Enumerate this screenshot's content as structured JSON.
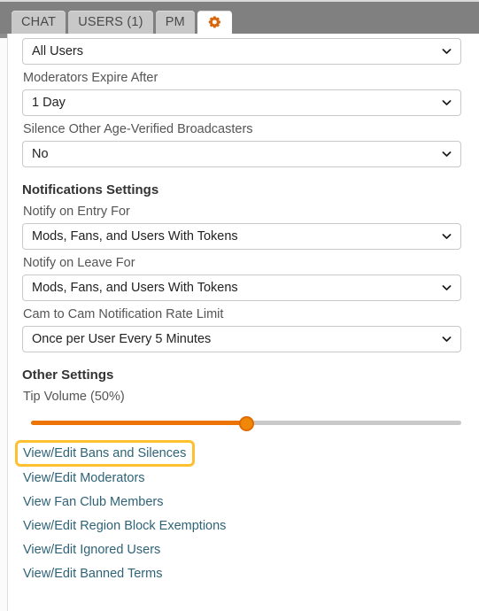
{
  "tabs": [
    {
      "label": "CHAT",
      "name": "tab-chat",
      "active": false,
      "icon": null
    },
    {
      "label": "USERS (1)",
      "name": "tab-users",
      "active": false,
      "icon": null
    },
    {
      "label": "PM",
      "name": "tab-pm",
      "active": false,
      "icon": null
    },
    {
      "label": "",
      "name": "tab-settings",
      "active": true,
      "icon": "gear-icon"
    }
  ],
  "settings": {
    "user_scope": {
      "label": "",
      "value": "All Users",
      "icon": "chevron-down-icon"
    },
    "moderators_expire": {
      "label": "Moderators Expire After",
      "value": "1 Day",
      "icon": "chevron-down-icon"
    },
    "silence_broadcasters": {
      "label": "Silence Other Age-Verified Broadcasters",
      "value": "No",
      "icon": "chevron-down-icon"
    }
  },
  "notifications": {
    "heading": "Notifications Settings",
    "notify_entry": {
      "label": "Notify on Entry For",
      "value": "Mods, Fans, and Users With Tokens",
      "icon": "chevron-down-icon"
    },
    "notify_leave": {
      "label": "Notify on Leave For",
      "value": "Mods, Fans, and Users With Tokens",
      "icon": "chevron-down-icon"
    },
    "cam_rate_limit": {
      "label": "Cam to Cam Notification Rate Limit",
      "value": "Once per User Every 5 Minutes",
      "icon": "chevron-down-icon"
    }
  },
  "other": {
    "heading": "Other Settings",
    "tip_volume": {
      "label": "Tip Volume (50%)",
      "percent": 50
    },
    "links": [
      {
        "label": "View/Edit Bans and Silences",
        "name": "link-bans-and-silences",
        "highlighted": true
      },
      {
        "label": "View/Edit Moderators",
        "name": "link-moderators",
        "highlighted": false
      },
      {
        "label": "View Fan Club Members",
        "name": "link-fan-club-members",
        "highlighted": false
      },
      {
        "label": "View/Edit Region Block Exemptions",
        "name": "link-region-block-exemptions",
        "highlighted": false
      },
      {
        "label": "View/Edit Ignored Users",
        "name": "link-ignored-users",
        "highlighted": false
      },
      {
        "label": "View/Edit Banned Terms",
        "name": "link-banned-terms",
        "highlighted": false
      }
    ]
  },
  "colors": {
    "accent_orange": "#ec7404",
    "tabbar_gray": "#808080",
    "link_blue": "#2e6377",
    "highlight_yellow": "#fdc130"
  }
}
